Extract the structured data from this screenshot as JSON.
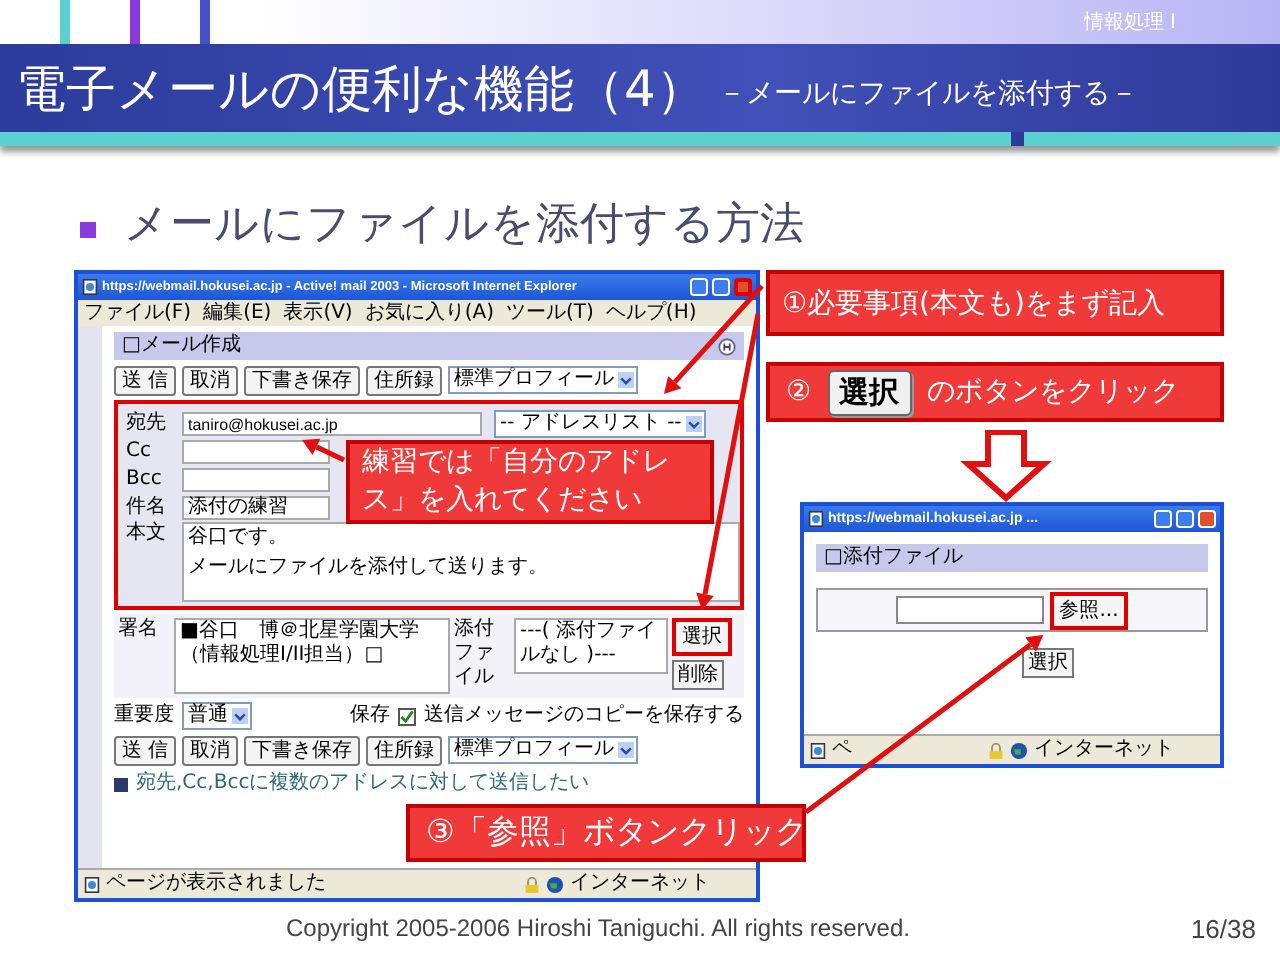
{
  "header": {
    "course": "情報処理 I",
    "title": "電子メールの便利な機能（4）",
    "subtitle": "－メールにファイルを添付する－"
  },
  "heading": "メールにファイルを添付する方法",
  "main_window": {
    "title": "https://webmail.hokusei.ac.jp - Active! mail 2003 - Microsoft Internet Explorer",
    "close_highlighted": true,
    "menu": [
      "ファイル(F)",
      "編集(E)",
      "表示(V)",
      "お気に入り(A)",
      "ツール(T)",
      "ヘルプ(H)"
    ],
    "panel_title": "□メール作成",
    "toolbar": [
      "送 信",
      "取消",
      "下書き保存",
      "住所録"
    ],
    "profile": "標準プロフィール",
    "form_highlighted": true,
    "fields": [
      {
        "label": "宛先",
        "value": "taniro@hokusei.ac.jp",
        "select": "-- アドレスリスト --"
      },
      {
        "label": "Cc"
      },
      {
        "label": "Bcc"
      },
      {
        "label": "件名",
        "value": "添付の練習"
      }
    ],
    "body": {
      "label": "本文",
      "lines": [
        "谷口です。",
        "メールにファイルを添付して送ります。"
      ]
    },
    "signature": {
      "label": "署名",
      "value": "■谷口　博＠北星学園大学（情報処理I/II担当）□"
    },
    "attachment": {
      "label": "添付ファイル",
      "value": "---( 添付ファイルなし )---",
      "buttons": [
        {
          "label": "選択",
          "highlighted": true
        },
        {
          "label": "削除",
          "highlighted": false
        }
      ]
    },
    "priority": {
      "label": "重要度",
      "value": "普通"
    },
    "save": {
      "label": "保存",
      "checked": true,
      "text": "送信メッセージのコピーを保存する"
    },
    "bottom_toolbar": [
      "送 信",
      "取消",
      "下書き保存",
      "住所録"
    ],
    "bottom_profile": "標準プロフィール",
    "note": "宛先,Cc,Bccに複数のアドレスに対して送信したい",
    "status": "ページが表示されました",
    "zone": "インターネット"
  },
  "callouts": {
    "step1": "①必要事項(本文も)をまず記入",
    "step2_number": "②",
    "step2_button": "選択",
    "step2_text": "のボタンをクリック",
    "practice": "練習では「自分のアドレス」を入れてください",
    "step3": "③「参照」ボタンクリック"
  },
  "popup": {
    "title": "https://webmail.hokusei.ac.jp ...",
    "panel_title": "□添付ファイル",
    "browse": {
      "label": "参照...",
      "highlighted": true
    },
    "select_button": "選択",
    "status": "ペ",
    "zone": "インターネット"
  },
  "footer": {
    "copyright": "Copyright 2005-2006 Hiroshi Taniguchi. All rights reserved.",
    "page": "16/38"
  }
}
